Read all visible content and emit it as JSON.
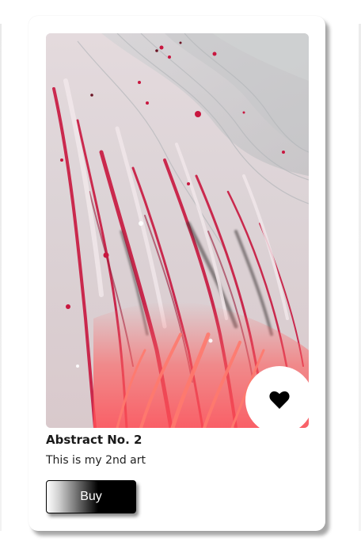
{
  "card": {
    "title": "Abstract No. 2",
    "description": "This is my 2nd art",
    "buy_label": "Buy",
    "favorite_icon": "heart-icon",
    "artwork_palette": [
      "#e6dde0",
      "#d8d8da",
      "#c2c4c6",
      "#d6204a",
      "#ff5a60",
      "#9a1b3a",
      "#3a3436"
    ]
  }
}
